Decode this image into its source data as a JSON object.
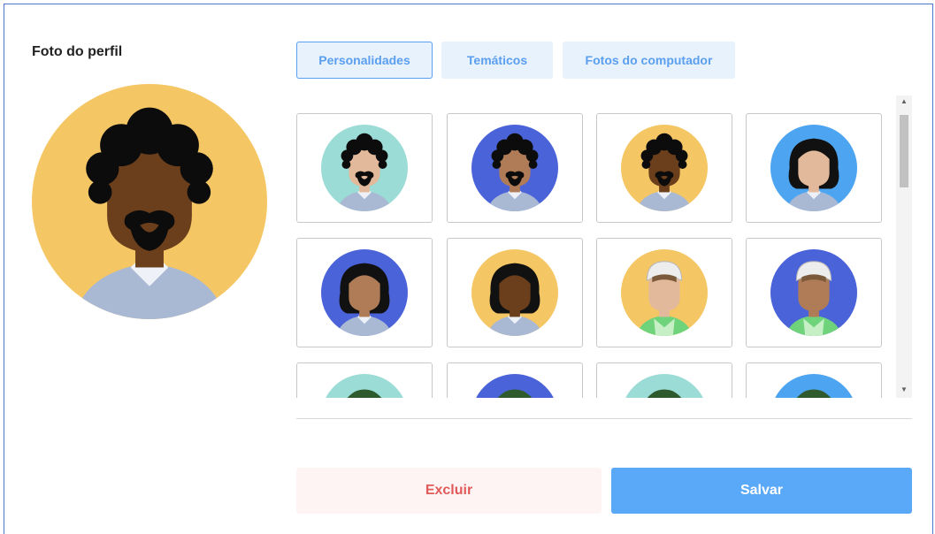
{
  "section_title": "Foto do perfil",
  "tabs": [
    {
      "label": "Personalidades",
      "active": true
    },
    {
      "label": "Temáticos",
      "active": false
    },
    {
      "label": "Fotos do computador",
      "active": false
    }
  ],
  "actions": {
    "delete_label": "Excluir",
    "save_label": "Salvar"
  },
  "colors": {
    "accent": "#5aa8f8",
    "tab_bg": "#e8f2fd",
    "delete_text": "#e05a5a",
    "bg_teal": "#9bdcd6",
    "bg_blue": "#4a63d8",
    "bg_yellow": "#f5c664",
    "bg_lightblue": "#4da4f0"
  },
  "selected_avatar": {
    "bg": "yellow",
    "skin": "dark",
    "hair": "curly",
    "beard": true
  },
  "avatars": [
    {
      "bg": "teal",
      "skin": "light",
      "hair": "curly",
      "beard": true
    },
    {
      "bg": "blue",
      "skin": "medium",
      "hair": "curly",
      "beard": true
    },
    {
      "bg": "yellow",
      "skin": "dark",
      "hair": "curly",
      "beard": true
    },
    {
      "bg": "lightblue",
      "skin": "light",
      "hair": "long",
      "beard": false
    },
    {
      "bg": "blue",
      "skin": "medium",
      "hair": "long",
      "beard": false
    },
    {
      "bg": "yellow",
      "skin": "dark",
      "hair": "long",
      "beard": false
    },
    {
      "bg": "yellow",
      "skin": "light",
      "hair": "cap",
      "beard": false
    },
    {
      "bg": "blue",
      "skin": "medium",
      "hair": "cap",
      "beard": false
    },
    {
      "bg": "teal",
      "skin": "light",
      "hair": "helmet",
      "beard": false
    },
    {
      "bg": "blue",
      "skin": "medium",
      "hair": "helmet",
      "beard": false
    },
    {
      "bg": "teal",
      "skin": "light",
      "hair": "helmet",
      "beard": false
    },
    {
      "bg": "lightblue",
      "skin": "medium",
      "hair": "helmet",
      "beard": false
    }
  ]
}
